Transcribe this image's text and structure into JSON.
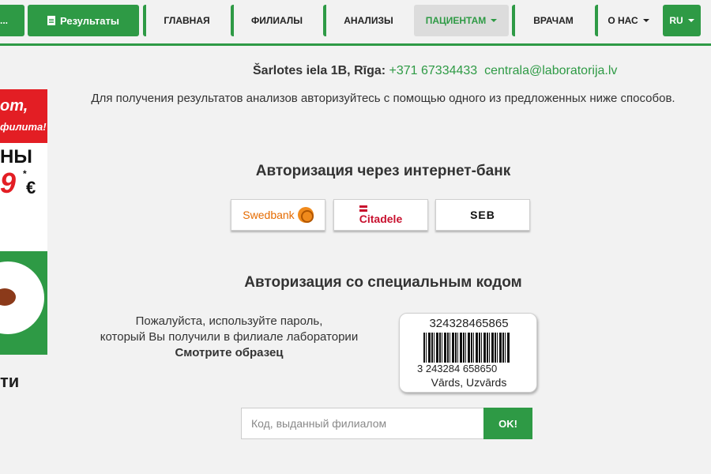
{
  "nav": {
    "first_label": "...",
    "results_label": "Результаты",
    "items": [
      {
        "label": "ГЛАВНАЯ"
      },
      {
        "label": "ФИЛИАЛЫ"
      },
      {
        "label": "АНАЛИЗЫ"
      },
      {
        "label": "ПАЦИЕНТАМ"
      },
      {
        "label": "ВРАЧАМ"
      },
      {
        "label": "О НАС"
      }
    ],
    "lang": "RU"
  },
  "banner": {
    "top_line": "от,",
    "sub_line": "филита!",
    "big_text": "НЫ",
    "price": "9",
    "star": "*",
    "currency": "€",
    "caption": "ти"
  },
  "contact": {
    "address": "Šarlotes iela 1B, Rīga:",
    "phone": "+371 67334433",
    "email": "centrala@laboratorija.lv"
  },
  "intro": "Для получения результатов анализов авторизуйтесь с помощью одного из предложенных ниже способов.",
  "bank_section": {
    "heading": "Авторизация через интернет-банк",
    "banks": [
      {
        "name": "Swedbank"
      },
      {
        "name": "Citadele"
      },
      {
        "name": "SEB"
      }
    ]
  },
  "code_section": {
    "heading": "Авторизация со специальным кодом",
    "line1": "Пожалуйста, используйте пароль,",
    "line2": "который Вы получили в филиале лаборатории",
    "sample_link": "Смотрите образец",
    "card_number": "324328465865",
    "card_digits": "3 243284 658650",
    "card_name": "Vārds, Uzvārds",
    "input_placeholder": "Код, выданный филиалом",
    "ok_label": "OK!"
  },
  "colors": {
    "brand_green": "#2e9a45",
    "swedbank_orange": "#e56b00",
    "citadele_red": "#c8102e"
  }
}
